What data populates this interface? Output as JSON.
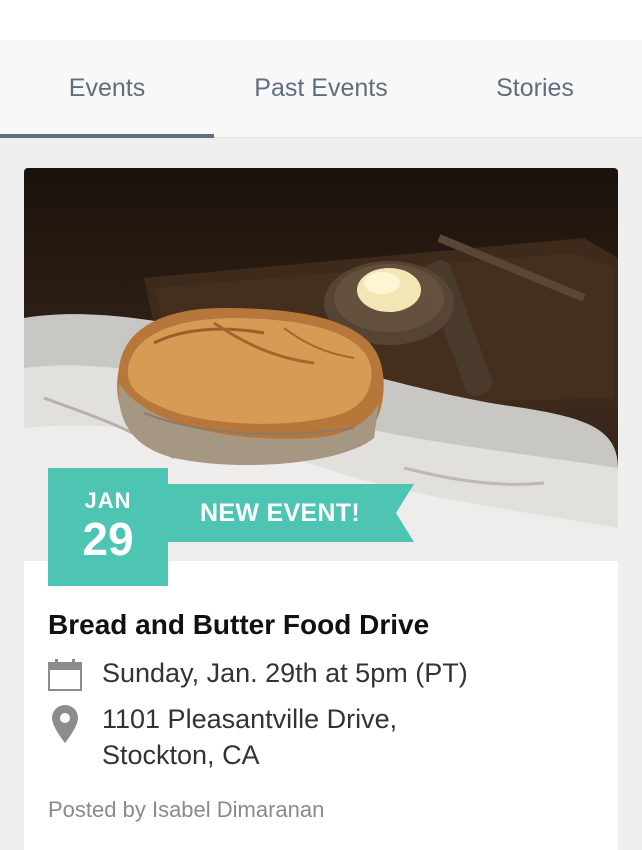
{
  "tabs": [
    {
      "label": "Events",
      "active": true
    },
    {
      "label": "Past Events",
      "active": false
    },
    {
      "label": "Stories",
      "active": false
    }
  ],
  "event": {
    "month": "JAN",
    "day": "29",
    "badge": "NEW EVENT!",
    "title": "Bread and Butter Food Drive",
    "datetime": "Sunday, Jan. 29th at 5pm (PT)",
    "address_line1": "1101 Pleasantville Drive,",
    "address_line2": "Stockton, CA",
    "posted_by": "Posted by Isabel Dimaranan",
    "image_icon": "bread-photo"
  },
  "colors": {
    "accent": "#4dc5b2",
    "tab_text": "#5d6f7e"
  },
  "icons": {
    "date": "calendar-icon",
    "location": "map-pin-icon"
  }
}
